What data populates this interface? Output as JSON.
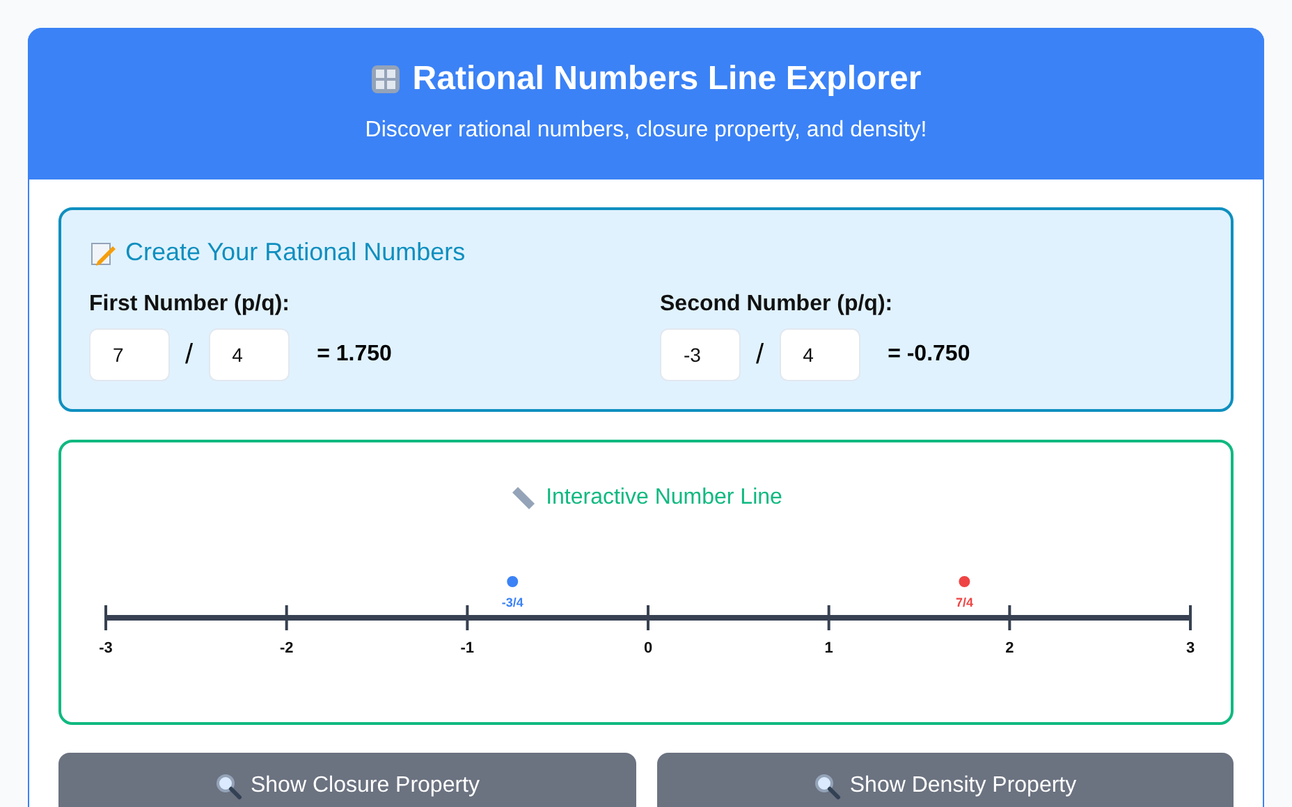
{
  "header": {
    "title": "Rational Numbers Line Explorer",
    "subtitle": "Discover rational numbers, closure property, and density!"
  },
  "create_panel": {
    "title": "Create Your Rational Numbers",
    "numbers": [
      {
        "label": "First Number (p/q):",
        "numerator": "7",
        "separator": "/",
        "denominator": "4",
        "result": "= 1.750"
      },
      {
        "label": "Second Number (p/q):",
        "numerator": "-3",
        "separator": "/",
        "denominator": "4",
        "result": "= -0.750"
      }
    ]
  },
  "number_line": {
    "title": "Interactive Number Line",
    "ticks": [
      "-3",
      "-2",
      "-1",
      "0",
      "1",
      "2",
      "3"
    ],
    "points": [
      {
        "label": "-3/4",
        "color": "#3b82f6"
      },
      {
        "label": "7/4",
        "color": "#ef4444"
      }
    ]
  },
  "buttons": [
    "Show Closure Property",
    "Show Density Property"
  ]
}
